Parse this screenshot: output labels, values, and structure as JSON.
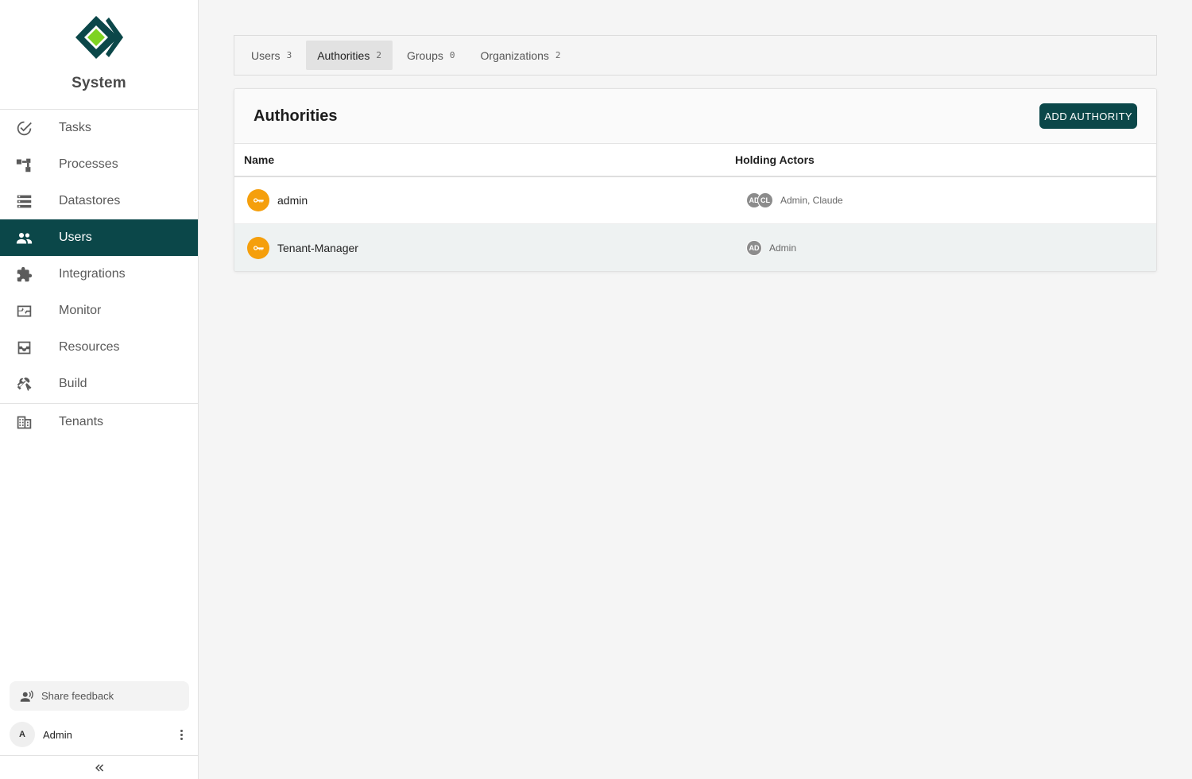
{
  "app": {
    "title": "System"
  },
  "sidebar": {
    "items": [
      {
        "label": "Tasks",
        "icon": "check-circle-icon"
      },
      {
        "label": "Processes",
        "icon": "process-flow-icon"
      },
      {
        "label": "Datastores",
        "icon": "database-list-icon"
      },
      {
        "label": "Users",
        "icon": "users-icon",
        "active": true
      },
      {
        "label": "Integrations",
        "icon": "puzzle-icon"
      },
      {
        "label": "Monitor",
        "icon": "monitor-pulse-icon"
      },
      {
        "label": "Resources",
        "icon": "inbox-tray-icon"
      },
      {
        "label": "Build",
        "icon": "tools-icon"
      },
      {
        "label": "Tenants",
        "icon": "building-icon"
      }
    ],
    "feedback_label": "Share feedback",
    "user": {
      "initial": "A",
      "name": "Admin"
    }
  },
  "tabs": [
    {
      "label": "Users",
      "count": "3"
    },
    {
      "label": "Authorities",
      "count": "2",
      "active": true
    },
    {
      "label": "Groups",
      "count": "0"
    },
    {
      "label": "Organizations",
      "count": "2"
    }
  ],
  "panel": {
    "title": "Authorities",
    "add_button": "ADD AUTHORITY",
    "columns": {
      "name": "Name",
      "actors": "Holding Actors"
    },
    "rows": [
      {
        "name": "admin",
        "avatars": [
          "AD",
          "CL"
        ],
        "actors": "Admin, Claude"
      },
      {
        "name": "Tenant-Manager",
        "avatars": [
          "AD"
        ],
        "actors": "Admin"
      }
    ]
  },
  "colors": {
    "accent": "#0b4749",
    "key_badge": "#f59f0c",
    "logo_green": "#7ed321"
  }
}
